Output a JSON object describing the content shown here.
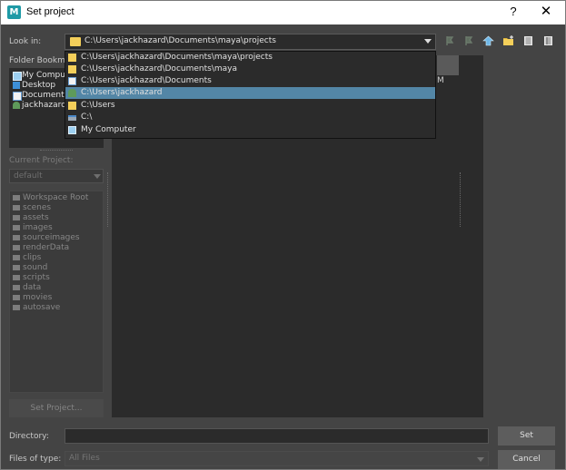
{
  "window": {
    "title": "Set project",
    "help_glyph": "?",
    "close_glyph": "✕",
    "app_icon_letter": "M"
  },
  "look_in": {
    "label": "Look in:",
    "value": "C:\\Users\\jackhazard\\Documents\\maya\\projects",
    "options": [
      {
        "text": "C:\\Users\\jackhazard\\Documents\\maya\\projects",
        "icon": "folder-icon"
      },
      {
        "text": "C:\\Users\\jackhazard\\Documents\\maya",
        "icon": "folder-icon"
      },
      {
        "text": "C:\\Users\\jackhazard\\Documents",
        "icon": "documents-icon"
      },
      {
        "text": "C:\\Users\\jackhazard",
        "icon": "user-icon",
        "selected": true
      },
      {
        "text": "C:\\Users",
        "icon": "folder-icon"
      },
      {
        "text": "C:\\",
        "icon": "drive-icon"
      },
      {
        "text": "My Computer",
        "icon": "computer-icon"
      }
    ]
  },
  "toolbar": [
    "back-icon",
    "forward-icon",
    "parent-folder-icon",
    "new-folder-icon",
    "list-view-icon",
    "detail-view-icon"
  ],
  "bookmarks": {
    "label": "Folder Bookm",
    "items": [
      {
        "label": "My Compu",
        "icon": "computer-icon"
      },
      {
        "label": "Desktop",
        "icon": "desktop-icon"
      },
      {
        "label": "Document",
        "icon": "documents-icon"
      },
      {
        "label": "jackhazarc",
        "icon": "user-icon"
      }
    ]
  },
  "current_project": {
    "label": "Current Project:",
    "value": "default"
  },
  "workspace": [
    "Workspace Root",
    "scenes",
    "assets",
    "images",
    "sourceimages",
    "renderData",
    "clips",
    "sound",
    "scripts",
    "data",
    "movies",
    "autosave"
  ],
  "buttons": {
    "set_project": "Set Project...",
    "set": "Set",
    "cancel": "Cancel"
  },
  "directory": {
    "label": "Directory:",
    "value": ""
  },
  "files_of_type": {
    "label": "Files of type:",
    "value": "All Files"
  },
  "main_column_letter": "M",
  "colors": {
    "selection": "#5386a6",
    "folder": "#f4cf5a",
    "background": "#444444",
    "panel": "#2b2b2b"
  }
}
